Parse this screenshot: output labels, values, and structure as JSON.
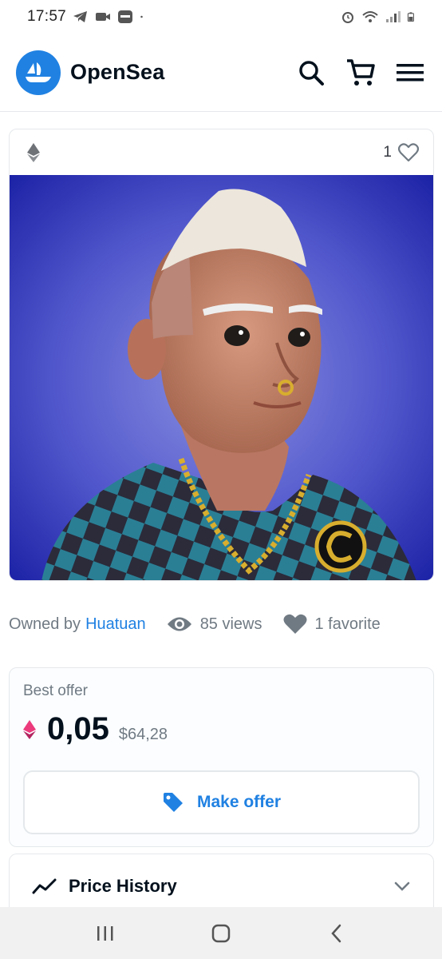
{
  "status_bar": {
    "time": "17:57",
    "left_icons": [
      "telegram-icon",
      "video-call-icon",
      "zalo-icon",
      "dot-icon"
    ],
    "right_icons": [
      "alarm-icon",
      "wifi-icon",
      "signal-icon",
      "battery-icon"
    ]
  },
  "header": {
    "brand": "OpenSea",
    "brand_color": "#2081e2",
    "icons": [
      "search-icon",
      "cart-icon",
      "menu-icon"
    ]
  },
  "item": {
    "chain_icon": "ethereum-icon",
    "favorites_count": "1",
    "image_alt": "3D avatar character with white hair, nose ring and gold chain on blue background"
  },
  "meta": {
    "owned_by_label": "Owned by",
    "owner": "Huatuan",
    "views": "85 views",
    "favorites": "1 favorite"
  },
  "offer": {
    "label": "Best offer",
    "price": "0,05",
    "fiat": "$64,28",
    "button_label": "Make offer"
  },
  "price_history": {
    "title": "Price History"
  },
  "system_nav": [
    "recent-apps-icon",
    "home-icon",
    "back-icon"
  ]
}
